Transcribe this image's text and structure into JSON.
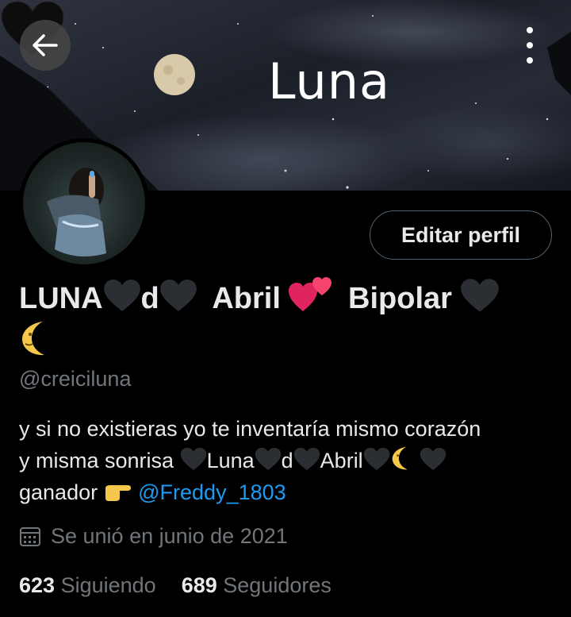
{
  "header": {
    "banner_title": "Luna",
    "back_icon": "arrow-left-icon",
    "more_icon": "more-vertical-icon"
  },
  "profile": {
    "edit_button_label": "Editar perfil",
    "name_parts": [
      "LUNA",
      "d",
      "Abril",
      "Bipolar"
    ],
    "handle": "@creiciluna",
    "bio_line1": "y si no existieras yo te inventaría mismo corazón",
    "bio_line2_start": "y misma sonrisa",
    "bio_luna": "Luna",
    "bio_d": "d",
    "bio_abril": "Abril",
    "bio_ganador": "ganador",
    "bio_mention": "@Freddy_1803",
    "joined": "Se unió en junio de 2021",
    "following_count": "623",
    "following_label": "Siguiendo",
    "followers_count": "689",
    "followers_label": "Seguidores"
  },
  "colors": {
    "background": "#000000",
    "text": "#e7e9ea",
    "secondary": "#71767b",
    "link": "#1d9bf0",
    "border": "#536471"
  }
}
